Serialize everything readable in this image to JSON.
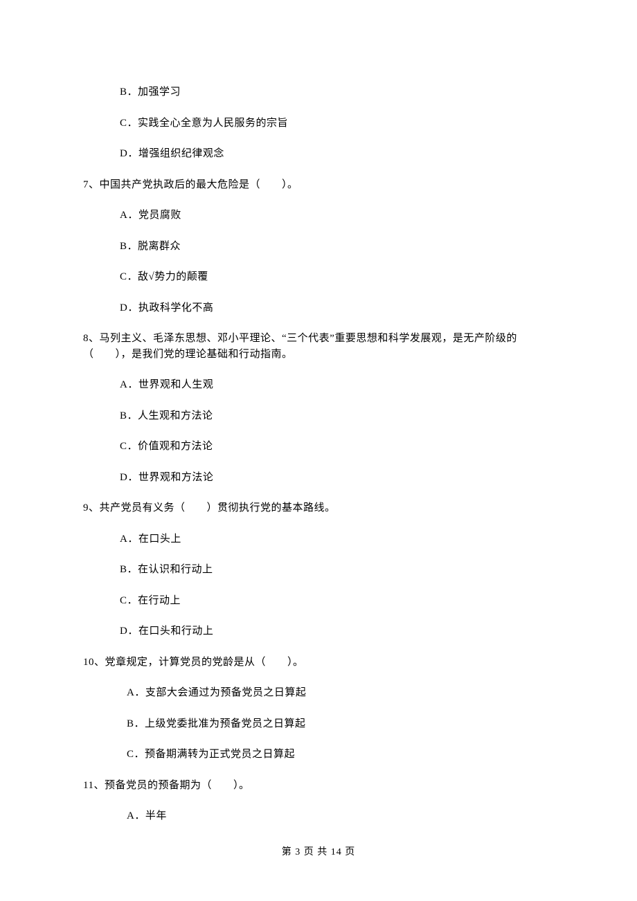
{
  "q6": {
    "opt_b": "B．加强学习",
    "opt_c": "C．实践全心全意为人民服务的宗旨",
    "opt_d": "D．增强组织纪律观念"
  },
  "q7": {
    "stem": "7、中国共产党执政后的最大危险是（　　）。",
    "opt_a": "A．党员腐败",
    "opt_b": "B．脱离群众",
    "opt_c": "C．敌√势力的颠覆",
    "opt_d": "D．执政科学化不高"
  },
  "q8": {
    "stem": "8、马列主义、毛泽东思想、邓小平理论、“三个代表”重要思想和科学发展观，是无产阶级的（　　），是我们党的理论基础和行动指南。",
    "opt_a": "A．世界观和人生观",
    "opt_b": "B．人生观和方法论",
    "opt_c": "C．价值观和方法论",
    "opt_d": "D．世界观和方法论"
  },
  "q9": {
    "stem": "9、共产党员有义务（　　）贯彻执行党的基本路线。",
    "opt_a": "A．在口头上",
    "opt_b": "B．在认识和行动上",
    "opt_c": "C．在行动上",
    "opt_d": "D．在口头和行动上"
  },
  "q10": {
    "stem": "10、党章规定，计算党员的党龄是从（　　）。",
    "opt_a": "A．支部大会通过为预备党员之日算起",
    "opt_b": "B．上级党委批准为预备党员之日算起",
    "opt_c": "C．预备期满转为正式党员之日算起"
  },
  "q11": {
    "stem": "11、预备党员的预备期为（　　）。",
    "opt_a": "A．半年"
  },
  "footer": "第 3 页 共 14 页"
}
